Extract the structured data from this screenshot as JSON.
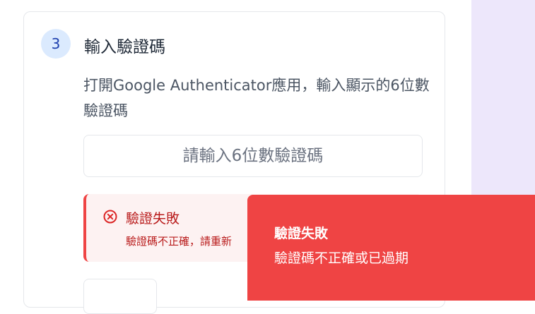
{
  "step": {
    "number": "3",
    "title": "輸入驗證碼",
    "instruction": "打開Google Authenticator應用，輸入顯示的6位數驗證碼"
  },
  "code_input": {
    "placeholder": "請輸入6位數驗證碼",
    "value": ""
  },
  "error_alert": {
    "icon": "x-circle-icon",
    "title": "驗證失敗",
    "message": "驗證碼不正確，請重新"
  },
  "toast": {
    "title": "驗證失敗",
    "message": "驗證碼不正確或已過期"
  },
  "colors": {
    "error": "#ef4444",
    "error_text": "#b91c1c",
    "badge_bg": "#dbeafe",
    "badge_text": "#1e40af",
    "right_panel": "#ede7fb"
  }
}
